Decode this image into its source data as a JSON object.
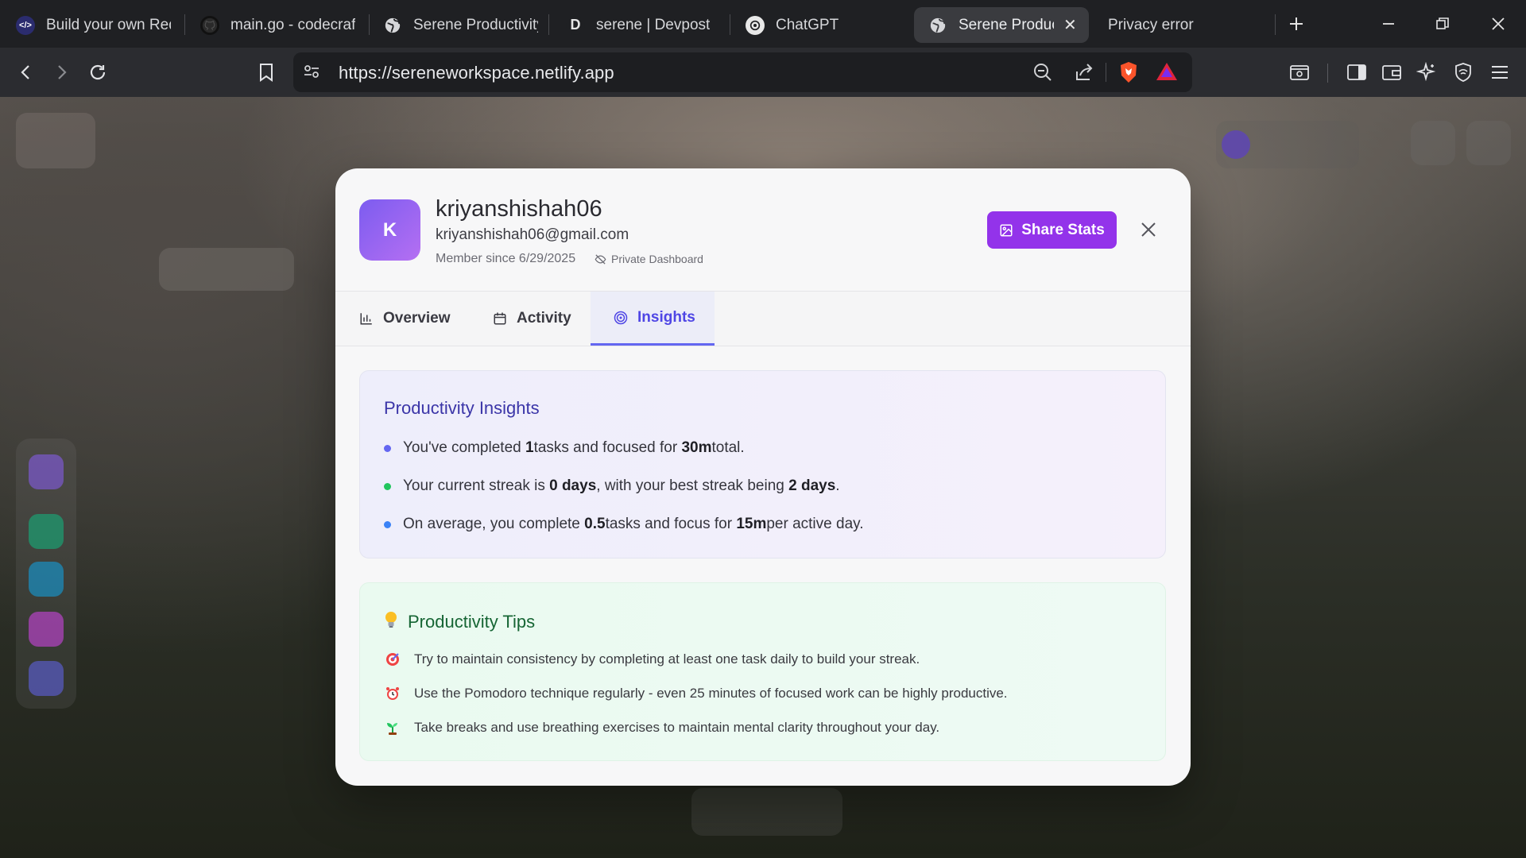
{
  "browser": {
    "tabs": [
      {
        "label": "Build your own Red",
        "icon": "codecrafters-icon"
      },
      {
        "label": "main.go - codecraft",
        "icon": "github-icon"
      },
      {
        "label": "Serene Productivity",
        "icon": "globe-icon"
      },
      {
        "label": "serene | Devpost",
        "icon": "devpost-icon",
        "badge": "D"
      },
      {
        "label": "ChatGPT",
        "icon": "openai-icon"
      },
      {
        "label": "Serene Produc",
        "icon": "globe-icon",
        "active": true
      },
      {
        "label": "Privacy error"
      }
    ],
    "url": "https://sereneworkspace.netlify.app"
  },
  "profile": {
    "avatar_letter": "K",
    "username": "kriyanshishah06",
    "email": "kriyanshishah06@gmail.com",
    "member_since": "Member since 6/29/2025",
    "privacy": "Private Dashboard",
    "share_label": "Share Stats"
  },
  "tabs": {
    "overview": "Overview",
    "activity": "Activity",
    "insights": "Insights",
    "active": "Insights"
  },
  "insights": {
    "title": "Productivity Insights",
    "items": [
      {
        "pre": "You've completed ",
        "b1": "1",
        "mid": " tasks and focused for ",
        "b2": "30m",
        "post": " total.",
        "dot": "#6366f1"
      },
      {
        "pre": "Your current streak is ",
        "b1": "0 days",
        "mid": ", with your best streak being ",
        "b2": "2 days",
        "post": ".",
        "dot": "#22c55e"
      },
      {
        "pre": "On average, you complete ",
        "b1": "0.5",
        "mid": " tasks and focus for ",
        "b2": "15m",
        "post": " per active day.",
        "dot": "#3b82f6"
      }
    ]
  },
  "tips": {
    "title": "Productivity Tips",
    "items": [
      {
        "icon": "target-icon",
        "text": "Try to maintain consistency by completing at least one task daily to build your streak."
      },
      {
        "icon": "alarm-clock-icon",
        "text": "Use the Pomodoro technique regularly - even 25 minutes of focused work can be highly productive."
      },
      {
        "icon": "seedling-icon",
        "text": "Take breaks and use breathing exercises to maintain mental clarity throughout your day."
      }
    ]
  },
  "colors": {
    "accent": "#9333ea",
    "tab_active": "#4f46e5",
    "tips_title": "#166534"
  }
}
